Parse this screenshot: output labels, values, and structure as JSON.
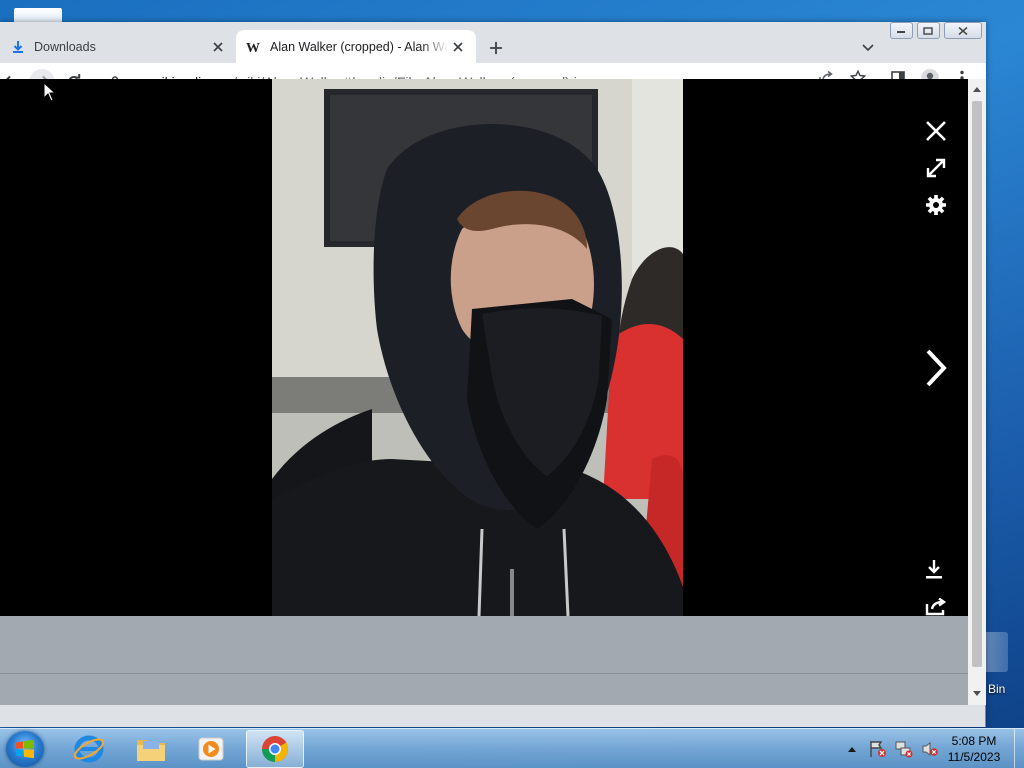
{
  "browser": {
    "tabs": [
      {
        "title": "Downloads",
        "favicon": "download-icon"
      },
      {
        "title": "Alan Walker (cropped) - Alan Walker",
        "favicon": "wikipedia-w-icon"
      }
    ],
    "url": {
      "host": "en.wikipedia.org",
      "path": "/wiki/Alan_Walker#/media/File:Alan_Walker_(cropped).jpg"
    }
  },
  "media_viewer": {
    "image_description": "Alan_Walker_(cropped).jpg",
    "controls": [
      "close-icon",
      "fullscreen-icon",
      "settings-gear-icon",
      "next-image-icon",
      "download-icon",
      "share-icon"
    ]
  },
  "desktop": {
    "recycle_bin_label": "Bin"
  },
  "taskbar": {
    "items": [
      "internet-explorer-icon",
      "file-explorer-icon",
      "media-player-icon",
      "chrome-icon"
    ],
    "clock": {
      "time": "5:08 PM",
      "date": "11/5/2023"
    }
  },
  "colors": {
    "accent": "#1a73e8",
    "viewer_bg": "#000000",
    "page_bg": "#a2a9b1"
  }
}
